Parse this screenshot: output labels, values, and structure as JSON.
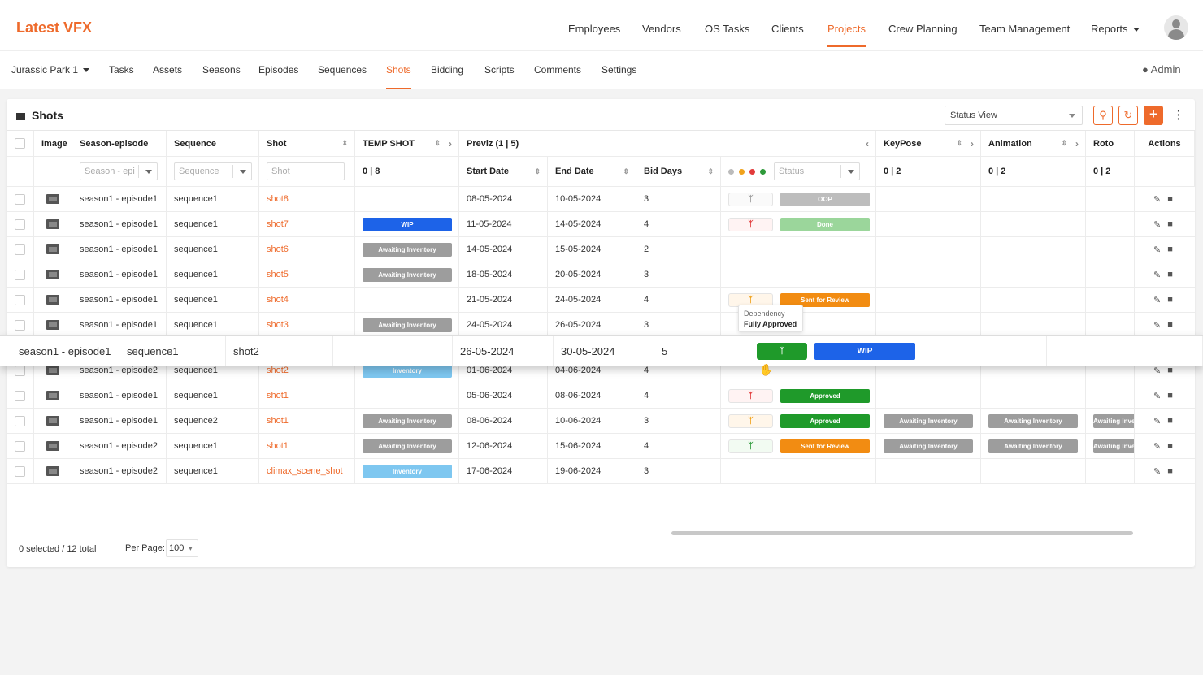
{
  "app": {
    "title": "Latest VFX"
  },
  "nav": {
    "items": [
      "Employees",
      "Vendors",
      "OS Tasks",
      "Clients",
      "Projects",
      "Crew Planning",
      "Team Management",
      "Reports"
    ],
    "active": "Projects"
  },
  "subnav": {
    "project": "Jurassic Park 1",
    "items": [
      "Tasks",
      "Assets",
      "Seasons",
      "Episodes",
      "Sequences",
      "Shots",
      "Bidding",
      "Scripts",
      "Comments",
      "Settings"
    ],
    "active": "Shots",
    "user": "Admin"
  },
  "panel": {
    "title": "Shots",
    "view_select": "Status View"
  },
  "table": {
    "headers": {
      "image": "Image",
      "season_episode": "Season-episode",
      "sequence": "Sequence",
      "shot": "Shot",
      "temp_shot": "TEMP SHOT",
      "previz": "Previz (1 | 5)",
      "keypose": "KeyPose",
      "animation": "Animation",
      "roto": "Roto",
      "actions": "Actions"
    },
    "subheaders": {
      "start": "Start Date",
      "end": "End Date",
      "bid": "Bid Days",
      "temp_count": "0 | 8",
      "keypose_count": "0 | 2",
      "animation_count": "0 | 2",
      "roto_count": "0 | 2"
    },
    "filters": {
      "season": "Season - epi",
      "sequence": "Sequence",
      "shot": "Shot",
      "status": "Status"
    },
    "rows": [
      {
        "season": "season1 - episode1",
        "sequence": "sequence1",
        "shot": "shot8",
        "temp": "",
        "start": "08-05-2024",
        "end": "10-05-2024",
        "bid": "3",
        "dep": "grey",
        "status": "OOP",
        "keypose": "",
        "animation": "",
        "roto": ""
      },
      {
        "season": "season1 - episode1",
        "sequence": "sequence1",
        "shot": "shot7",
        "temp": "WIP",
        "start": "11-05-2024",
        "end": "14-05-2024",
        "bid": "4",
        "dep": "red",
        "status": "Done",
        "keypose": "",
        "animation": "",
        "roto": ""
      },
      {
        "season": "season1 - episode1",
        "sequence": "sequence1",
        "shot": "shot6",
        "temp": "Awaiting Inventory",
        "start": "14-05-2024",
        "end": "15-05-2024",
        "bid": "2",
        "dep": "",
        "status": "",
        "keypose": "",
        "animation": "",
        "roto": ""
      },
      {
        "season": "season1 - episode1",
        "sequence": "sequence1",
        "shot": "shot5",
        "temp": "Awaiting Inventory",
        "start": "18-05-2024",
        "end": "20-05-2024",
        "bid": "3",
        "dep": "",
        "status": "",
        "keypose": "",
        "animation": "",
        "roto": ""
      },
      {
        "season": "season1 - episode1",
        "sequence": "sequence1",
        "shot": "shot4",
        "temp": "",
        "start": "21-05-2024",
        "end": "24-05-2024",
        "bid": "4",
        "dep": "orange",
        "status": "Sent for Review",
        "keypose": "",
        "animation": "",
        "roto": ""
      },
      {
        "season": "season1 - episode1",
        "sequence": "sequence1",
        "shot": "shot3",
        "temp": "Awaiting Inventory",
        "start": "24-05-2024",
        "end": "26-05-2024",
        "bid": "3",
        "dep": "",
        "status": "",
        "keypose": "",
        "animation": "",
        "roto": ""
      },
      {
        "season": "season1 - episode2",
        "sequence": "sequence1",
        "shot": "shot2",
        "temp": "Inventory",
        "start": "01-06-2024",
        "end": "04-06-2024",
        "bid": "4",
        "dep": "",
        "status": "",
        "keypose": "",
        "animation": "",
        "roto": ""
      },
      {
        "season": "season1 - episode1",
        "sequence": "sequence1",
        "shot": "shot1",
        "temp": "",
        "start": "05-06-2024",
        "end": "08-06-2024",
        "bid": "4",
        "dep": "red",
        "status": "Approved",
        "keypose": "",
        "animation": "",
        "roto": ""
      },
      {
        "season": "season1 - episode1",
        "sequence": "sequence2",
        "shot": "shot1",
        "temp": "Awaiting Inventory",
        "start": "08-06-2024",
        "end": "10-06-2024",
        "bid": "3",
        "dep": "orange",
        "status": "Approved",
        "keypose": "Awaiting Inventory",
        "animation": "Awaiting Inventory",
        "roto": "Awaiting Inventory"
      },
      {
        "season": "season1 - episode2",
        "sequence": "sequence1",
        "shot": "shot1",
        "temp": "Awaiting Inventory",
        "start": "12-06-2024",
        "end": "15-06-2024",
        "bid": "4",
        "dep": "green",
        "status": "Sent for Review",
        "keypose": "Awaiting Inventory",
        "animation": "Awaiting Inventory",
        "roto": "Awaiting Inventory"
      },
      {
        "season": "season1 - episode2",
        "sequence": "sequence1",
        "shot": "climax_scene_shot",
        "temp": "Inventory",
        "start": "17-06-2024",
        "end": "19-06-2024",
        "bid": "3",
        "dep": "",
        "status": "",
        "keypose": "",
        "animation": "",
        "roto": ""
      }
    ]
  },
  "dragged_row": {
    "season": "season1 - episode1",
    "sequence": "sequence1",
    "shot": "shot2",
    "start": "26-05-2024",
    "end": "30-05-2024",
    "bid": "5",
    "status": "WIP"
  },
  "tooltip": {
    "label": "Dependency",
    "value": "Fully Approved"
  },
  "footer": {
    "selection": "0 selected / 12 total",
    "per_page_label": "Per Page:",
    "per_page": "100"
  },
  "colors": {
    "brand": "#ee6a2b",
    "OOP": "#bdbdbd",
    "Done": "#9bd69b",
    "WIP": "#1d63e8",
    "Approved": "#1f9a2a",
    "Sent for Review": "#f28c12",
    "Awaiting Inventory": "#9d9d9d",
    "Inventory": "#7ec7f0",
    "dep_grey": "#9a9a9a",
    "dep_red": "#e23a3a",
    "dep_orange": "#f0a21c",
    "dep_green": "#2e9a3a"
  }
}
